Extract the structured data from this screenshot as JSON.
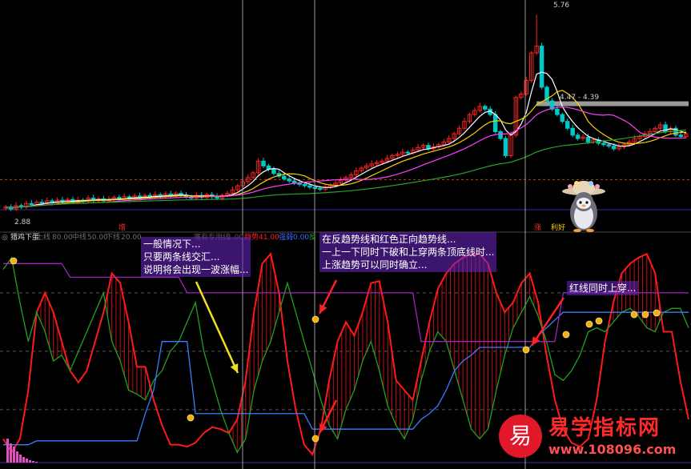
{
  "price_panel": {
    "high_label": "5.76",
    "low_label": "2.88",
    "range_label": "4.47 - 4.39",
    "markers": {
      "increase": "增",
      "rise": "涨",
      "good_news": "利好"
    }
  },
  "indicator_panel": {
    "name": "猎鸡下蛋",
    "legend": [
      {
        "label": "上线",
        "value": "80.00",
        "color": "#6e6e6e"
      },
      {
        "label": "中线",
        "value": "50.00",
        "color": "#6e6e6e"
      },
      {
        "label": "下线",
        "value": "20.00",
        "color": "#6e6e6e"
      }
    ],
    "extra_legend": [
      {
        "label": "嘴有专用线",
        "value": "1.00",
        "color": "#555555"
      },
      {
        "label": "趋势",
        "value": "41.00",
        "color": "#ff2020"
      },
      {
        "label": "强弱",
        "value": "0.00",
        "color": "#3a6cff"
      },
      {
        "label": "反",
        "value": "",
        "color": "#22aa22"
      }
    ]
  },
  "annotations": {
    "left": [
      "一般情况下...",
      "只要两条线交汇...",
      "说明将会出现一波涨幅..."
    ],
    "middle": [
      "在反趋势线和红色正向趋势线...",
      "一上一下同时下破和上穿两条顶底线时...",
      "上涨趋势可以同时确立..."
    ],
    "right": [
      "红线同时上穿..."
    ]
  },
  "watermark": {
    "badge": "易",
    "title": "易学指标网",
    "url": "www.108096.com"
  },
  "colors": {
    "up": "#ff2020",
    "down": "#00c8c8",
    "ma5": "#ffffff",
    "ma10": "#ffd000",
    "ma20": "#ff40ff",
    "ma60": "#2aa02a",
    "trend": "#ff1a1a",
    "counter": "#22a022",
    "strength": "#3a7bff",
    "top": "#a020c0",
    "arrow": "#ff2020",
    "note_arrow": "#f0e020"
  },
  "chart_data": [
    {
      "type": "candlestick",
      "title": "",
      "y_min": 2.88,
      "y_max": 5.76,
      "ylim": [
        2.7,
        5.95
      ],
      "reference_line": 3.35,
      "range_band": [
        4.39,
        4.47
      ],
      "closes": [
        2.95,
        2.92,
        2.97,
        2.95,
        3.0,
        2.98,
        3.02,
        3.0,
        3.04,
        3.01,
        3.05,
        3.03,
        3.06,
        3.02,
        3.05,
        3.04,
        3.08,
        3.05,
        3.07,
        3.04,
        3.06,
        3.09,
        3.06,
        3.1,
        3.07,
        3.11,
        3.08,
        3.12,
        3.09,
        3.13,
        3.1,
        3.14,
        3.11,
        3.15,
        3.12,
        3.1,
        3.08,
        3.12,
        3.09,
        3.13,
        3.1,
        3.08,
        3.12,
        3.15,
        3.2,
        3.26,
        3.32,
        3.38,
        3.45,
        3.62,
        3.55,
        3.5,
        3.44,
        3.4,
        3.36,
        3.33,
        3.3,
        3.28,
        3.26,
        3.24,
        3.22,
        3.21,
        3.24,
        3.27,
        3.3,
        3.34,
        3.38,
        3.42,
        3.48,
        3.52,
        3.55,
        3.58,
        3.6,
        3.62,
        3.66,
        3.7,
        3.72,
        3.75,
        3.74,
        3.78,
        3.82,
        3.85,
        3.8,
        3.83,
        3.86,
        3.9,
        3.95,
        4.02,
        4.1,
        4.2,
        4.3,
        4.36,
        4.42,
        4.38,
        4.3,
        4.05,
        3.95,
        3.7,
        4.0,
        4.55,
        4.6,
        4.8,
        5.2,
        5.3,
        4.7,
        4.5,
        4.38,
        4.3,
        4.2,
        4.1,
        4.0,
        3.95,
        3.97,
        3.9,
        3.93,
        3.88,
        3.86,
        3.84,
        3.8,
        3.83,
        3.86,
        3.9,
        3.95,
        3.98,
        4.02,
        4.05,
        4.1,
        4.15,
        4.05,
        4.1,
        4.0,
        3.98,
        4.02
      ],
      "highs_labelled": {
        "index": 103,
        "value": 5.76
      }
    },
    {
      "type": "line",
      "title": "",
      "ylim": [
        -8,
        105
      ],
      "gridlines": [
        80,
        50,
        20
      ],
      "series": [
        {
          "name": "趋势",
          "values": [
            5,
            -2,
            5,
            30,
            70,
            80,
            70,
            55,
            40,
            34,
            40,
            55,
            70,
            90,
            85,
            65,
            42,
            42,
            25,
            12,
            2,
            2,
            1,
            3,
            8,
            11,
            10,
            8,
            15,
            35,
            70,
            95,
            100,
            80,
            45,
            20,
            2,
            -3,
            10,
            35,
            55,
            65,
            58,
            70,
            85,
            86,
            65,
            35,
            30,
            25,
            45,
            65,
            82,
            90,
            95,
            98,
            100,
            100,
            95,
            80,
            70,
            75,
            85,
            90,
            75,
            48,
            25,
            10,
            3,
            1,
            5,
            25,
            55,
            75,
            90,
            95,
            98,
            100,
            90,
            60,
            60,
            35,
            15
          ]
        },
        {
          "name": "反",
          "values": [
            92,
            98,
            75,
            55,
            70,
            60,
            45,
            48,
            40,
            50,
            60,
            70,
            80,
            55,
            45,
            30,
            28,
            25,
            35,
            40,
            50,
            55,
            65,
            75,
            50,
            35,
            20,
            8,
            -2,
            5,
            30,
            45,
            55,
            70,
            85,
            70,
            55,
            40,
            25,
            12,
            5,
            20,
            30,
            45,
            55,
            40,
            22,
            12,
            5,
            15,
            35,
            50,
            60,
            55,
            40,
            25,
            10,
            5,
            10,
            30,
            48,
            62,
            70,
            78,
            68,
            55,
            38,
            35,
            40,
            48,
            60,
            62,
            60,
            65,
            70,
            72,
            68,
            62,
            60,
            70,
            72,
            72,
            62
          ]
        },
        {
          "name": "强弱",
          "values": [
            2,
            2,
            2,
            2,
            4,
            4,
            4,
            4,
            4,
            4,
            4,
            4,
            4,
            4,
            4,
            4,
            4,
            18,
            30,
            55,
            55,
            55,
            55,
            18,
            18,
            18,
            18,
            18,
            18,
            18,
            18,
            18,
            18,
            18,
            18,
            18,
            18,
            10,
            10,
            10,
            10,
            10,
            10,
            10,
            10,
            10,
            10,
            10,
            10,
            10,
            15,
            18,
            22,
            30,
            40,
            45,
            48,
            52,
            52,
            52,
            52,
            52,
            52,
            52,
            58,
            62,
            66,
            70,
            70,
            70,
            70,
            70,
            70,
            70,
            70,
            70,
            70,
            70,
            70,
            70,
            70,
            70,
            70
          ]
        },
        {
          "name": "顶底线",
          "values": [
            95,
            95,
            95,
            95,
            95,
            95,
            95,
            95,
            88,
            88,
            88,
            88,
            88,
            88,
            88,
            88,
            88,
            88,
            88,
            88,
            88,
            88,
            80,
            80,
            80,
            80,
            80,
            80,
            80,
            80,
            80,
            80,
            80,
            80,
            80,
            80,
            80,
            80,
            80,
            80,
            80,
            80,
            80,
            80,
            80,
            80,
            80,
            80,
            80,
            80,
            55,
            55,
            55,
            55,
            55,
            55,
            55,
            55,
            55,
            55,
            55,
            55,
            55,
            55,
            55,
            55,
            55,
            80,
            80,
            80,
            80,
            80,
            80,
            80,
            80,
            80,
            80,
            80,
            80,
            80,
            80,
            80,
            80
          ]
        }
      ]
    }
  ]
}
